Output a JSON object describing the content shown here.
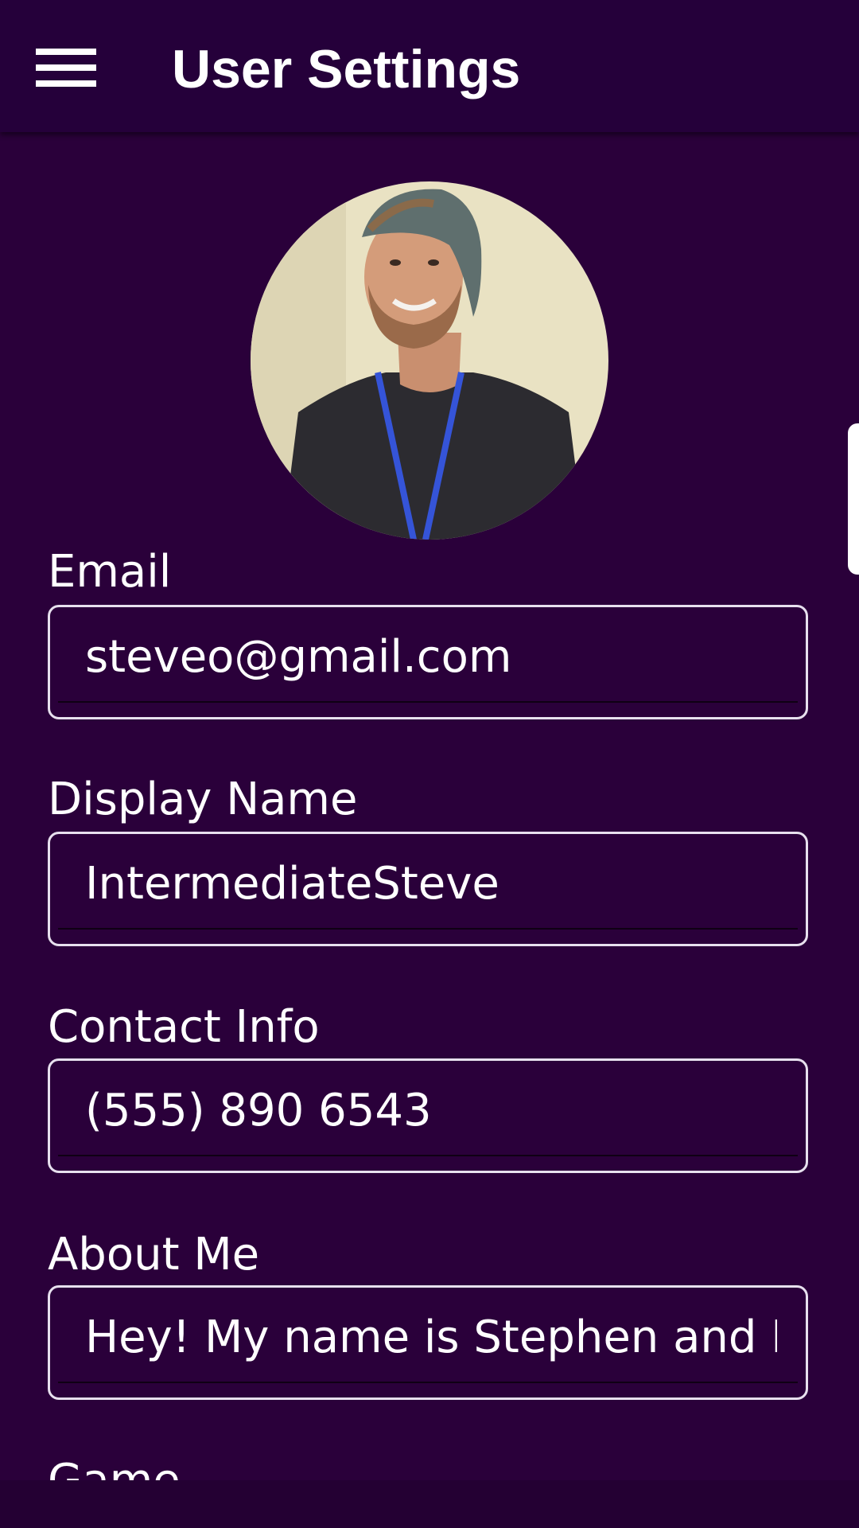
{
  "toolbar": {
    "title": "User Settings",
    "menu_icon": "hamburger-menu-icon"
  },
  "profile": {
    "avatar_icon": "profile-photo"
  },
  "fields": [
    {
      "label": "Email",
      "value": "steveo@gmail.com"
    },
    {
      "label": "Display Name",
      "value": "IntermediateSteve"
    },
    {
      "label": "Contact Info",
      "value": "(555) 890 6543"
    },
    {
      "label": "About Me",
      "value": "Hey! My name is Stephen and I li"
    }
  ],
  "next_section": {
    "label": "Game"
  },
  "colors": {
    "background": "#2a003a",
    "toolbar": "#25003a",
    "text": "#ffffff",
    "field_border": "#e7e0ee"
  }
}
